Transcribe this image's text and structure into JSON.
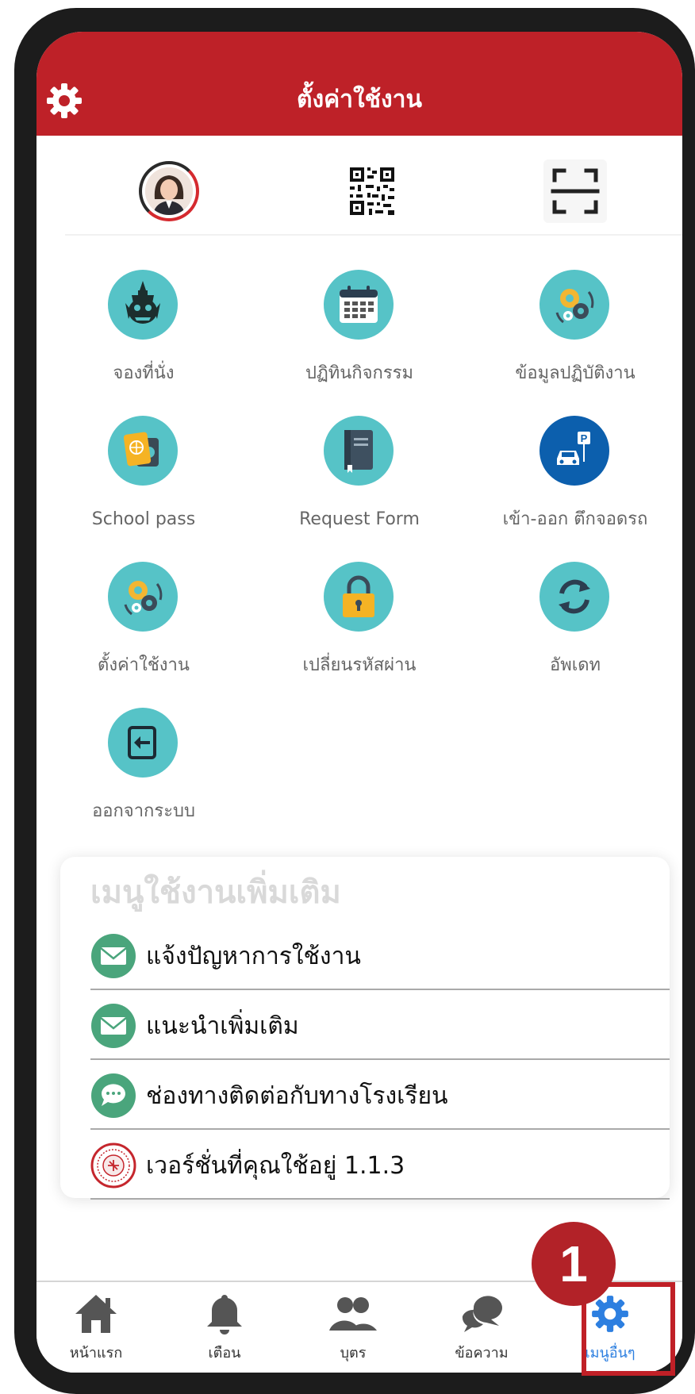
{
  "header": {
    "title": "ตั้งค่าใช้งาน"
  },
  "quick_row": {
    "items": [
      {
        "name": "profile-avatar"
      },
      {
        "name": "qr-code"
      },
      {
        "name": "scan"
      }
    ]
  },
  "menu_grid": [
    {
      "label": "จองที่นั่ง",
      "icon": "giant-statue-icon"
    },
    {
      "label": "ปฏิทินกิจกรรม",
      "icon": "calendar-icon"
    },
    {
      "label": "ข้อมูลปฏิบัติงาน",
      "icon": "gears-icon"
    },
    {
      "label": "School pass",
      "icon": "passport-icon"
    },
    {
      "label": "Request Form",
      "icon": "book-icon"
    },
    {
      "label": "เข้า-ออก ตึกจอดรถ",
      "icon": "parking-car-icon"
    },
    {
      "label": "ตั้งค่าใช้งาน",
      "icon": "gears-icon"
    },
    {
      "label": "เปลี่ยนรหัสผ่าน",
      "icon": "lock-icon"
    },
    {
      "label": "อัพเดท",
      "icon": "refresh-icon"
    },
    {
      "label": "ออกจากระบบ",
      "icon": "logout-icon"
    }
  ],
  "more_menu": {
    "title": "เมนูใช้งานเพิ่มเติม",
    "items": [
      {
        "label": "แจ้งปัญหาการใช้งาน",
        "icon": "mail-icon"
      },
      {
        "label": "แนะนำเพิ่มเติม",
        "icon": "mail-icon"
      },
      {
        "label": "ช่องทางติดต่อกับทางโรงเรียน",
        "icon": "chat-icon"
      },
      {
        "label": "เวอร์ชั่นที่คุณใช้อยู่ 1.1.3",
        "icon": "school-seal-icon"
      }
    ]
  },
  "bottom_nav": [
    {
      "label": "หน้าแรก",
      "icon": "home-icon"
    },
    {
      "label": "เตือน",
      "icon": "bell-icon"
    },
    {
      "label": "บุตร",
      "icon": "users-icon"
    },
    {
      "label": "ข้อความ",
      "icon": "chat-bubbles-icon"
    },
    {
      "label": "เมนูอื่นๆ",
      "icon": "gear-icon",
      "active": true
    }
  ],
  "annotation": {
    "step_number": "1"
  },
  "colors": {
    "header": "#be2128",
    "teal": "#56c3c7",
    "active": "#2d7fe0",
    "green": "#4aa57c"
  }
}
